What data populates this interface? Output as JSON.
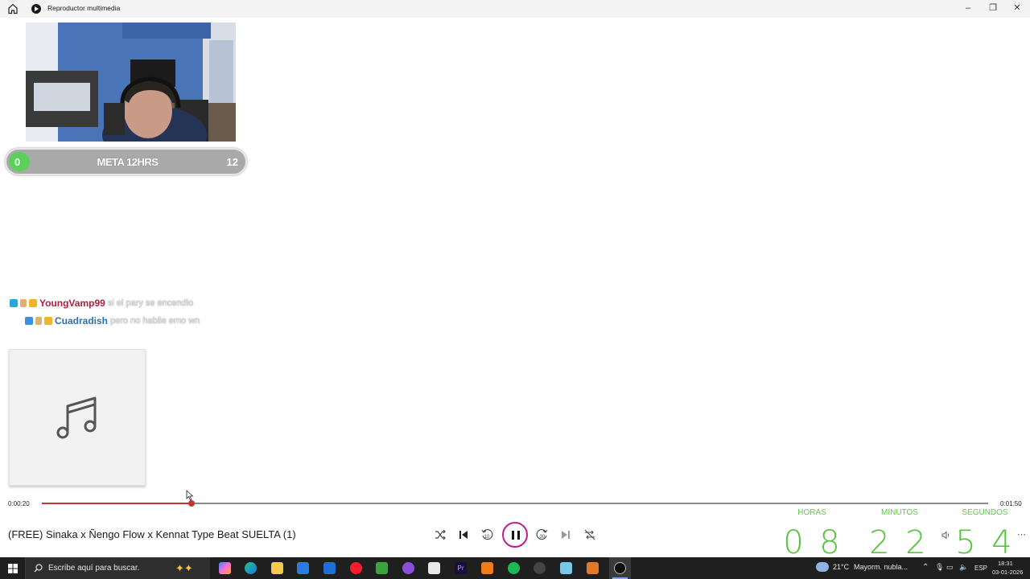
{
  "window": {
    "title": "Reproductor multimedia",
    "minimize": "–",
    "maximize": "❐",
    "close": "✕"
  },
  "overlay": {
    "goal": {
      "current": "0",
      "label": "META 12HRS",
      "target": "12"
    },
    "chat": [
      {
        "user": "YoungVamp99",
        "user_color": "#b01e3c",
        "message": "si el pary se encendio"
      },
      {
        "user": "Cuadradish",
        "user_color": "#2f6fb3",
        "message": "pero no hablie emo wn"
      }
    ]
  },
  "player": {
    "elapsed": "0:00:20",
    "duration": "0:01:50",
    "progress_fraction": 0.158,
    "track_title": "(FREE) Sinaka x Ñengo Flow x Kennat Type Beat SUELTA (1)",
    "controls": {
      "shuffle": "shuffle-icon",
      "previous": "previous-icon",
      "rewind": "10",
      "playpause": "pause-icon",
      "forward": "30",
      "next": "next-icon",
      "repeat": "repeat-icon"
    },
    "volume_icon": "volume-icon",
    "more_icon": "⋯"
  },
  "countdown": {
    "labels": {
      "hours": "HORAS",
      "minutes": "MINUTOS",
      "seconds": "SEGUNDOS"
    },
    "hours": [
      "0",
      "8"
    ],
    "minutes": [
      "2",
      "2"
    ],
    "seconds": [
      "5",
      "4"
    ],
    "color": "#55c43a"
  },
  "taskbar": {
    "search_placeholder": "Escribe aquí para buscar.",
    "weather_temp": "21°C",
    "weather_text": "Mayorm. nubla...",
    "language": "ESP",
    "time": "18:31",
    "date": "03-01-2026"
  }
}
